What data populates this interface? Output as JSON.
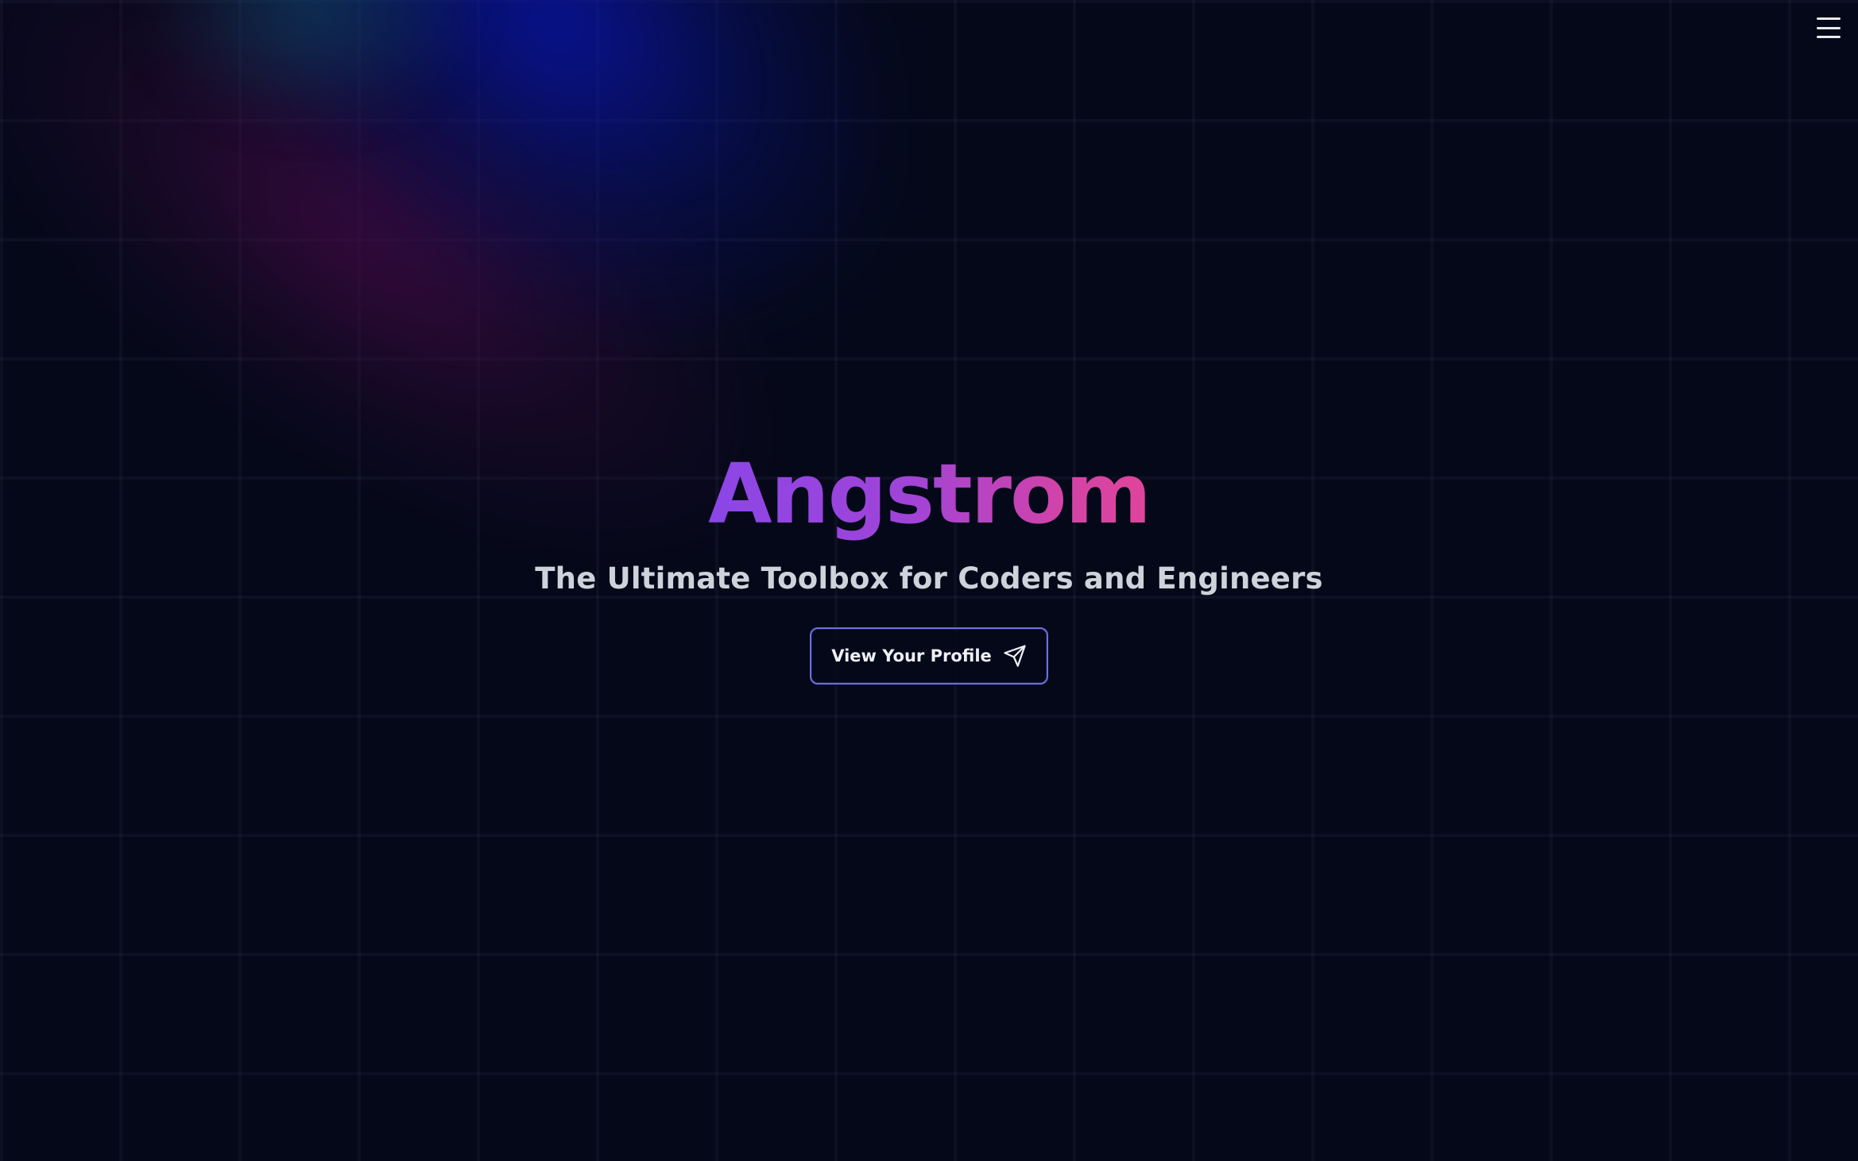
{
  "nav": {
    "menu_icon": "hamburger-menu-icon"
  },
  "hero": {
    "title": "Angstrom",
    "subtitle": "The Ultimate Toolbox for Coders and Engineers",
    "cta_label": "View Your Profile",
    "cta_icon": "send-icon"
  },
  "colors": {
    "background": "#040818",
    "title_gradient_start": "#8b46e6",
    "title_gradient_end": "#e0449a",
    "button_border": "#6e6fe0",
    "subtitle": "#cfd2da"
  }
}
